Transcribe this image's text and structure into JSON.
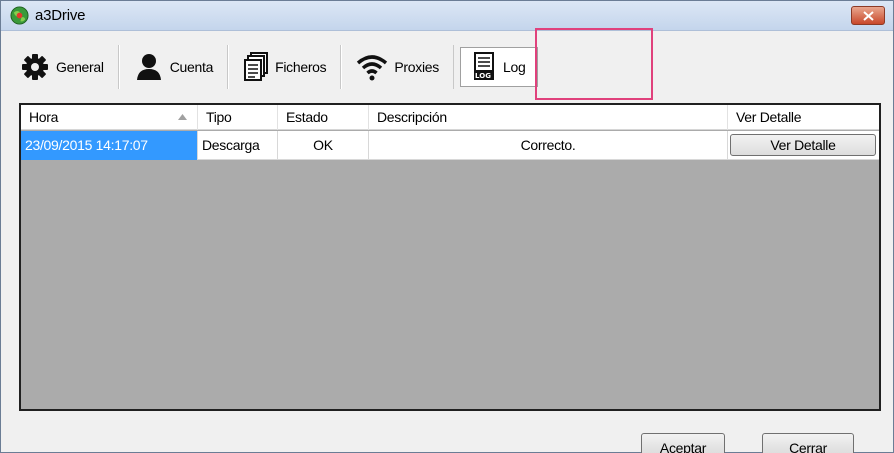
{
  "window": {
    "title": "a3Drive",
    "app_icon": "globe-app-icon",
    "close_icon": "close-icon"
  },
  "tabs": [
    {
      "label": "General",
      "icon": "gear-icon"
    },
    {
      "label": "Cuenta",
      "icon": "user-icon"
    },
    {
      "label": "Ficheros",
      "icon": "documents-icon"
    },
    {
      "label": "Proxies",
      "icon": "wifi-icon"
    },
    {
      "label": "Log",
      "icon": "log-icon",
      "selected": true
    }
  ],
  "grid": {
    "columns": [
      "Hora",
      "Tipo",
      "Estado",
      "Descripción",
      "Ver Detalle"
    ],
    "sorted_column": "Hora",
    "rows": [
      {
        "hora": "23/09/2015 14:17:07",
        "tipo": "Descarga",
        "estado": "OK",
        "descripcion": "Correcto.",
        "ver_detalle": "Ver Detalle"
      }
    ]
  },
  "buttons": {
    "aceptar": "Aceptar",
    "cerrar": "Cerrar"
  },
  "colors": {
    "selection": "#3399ff",
    "highlight": "#e0417c",
    "grid_empty": "#ababab"
  }
}
